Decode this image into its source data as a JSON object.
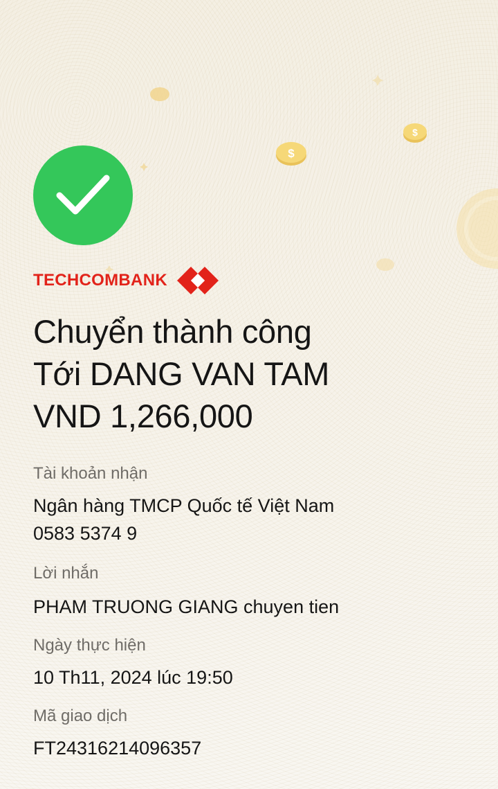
{
  "status": {
    "icon": "checkmark-icon",
    "color": "#34c75a"
  },
  "brand": {
    "name": "TECHCOMBANK",
    "color": "#e2231a",
    "logo_icon": "techcombank-logo-icon"
  },
  "headline": {
    "line1": "Chuyển thành công",
    "line2": "Tới DANG VAN TAM",
    "line3": "VND 1,266,000"
  },
  "details": {
    "receiving_account": {
      "label": "Tài khoản nhận",
      "bank": "Ngân hàng TMCP Quốc tế Việt Nam",
      "account_number": "0583 5374 9"
    },
    "message": {
      "label": "Lời nhắn",
      "value": "PHAM TRUONG GIANG chuyen tien"
    },
    "date": {
      "label": "Ngày thực hiện",
      "value": "10 Th11, 2024 lúc 19:50"
    },
    "transaction_id": {
      "label": "Mã giao dịch",
      "value": "FT24316214096357"
    }
  }
}
